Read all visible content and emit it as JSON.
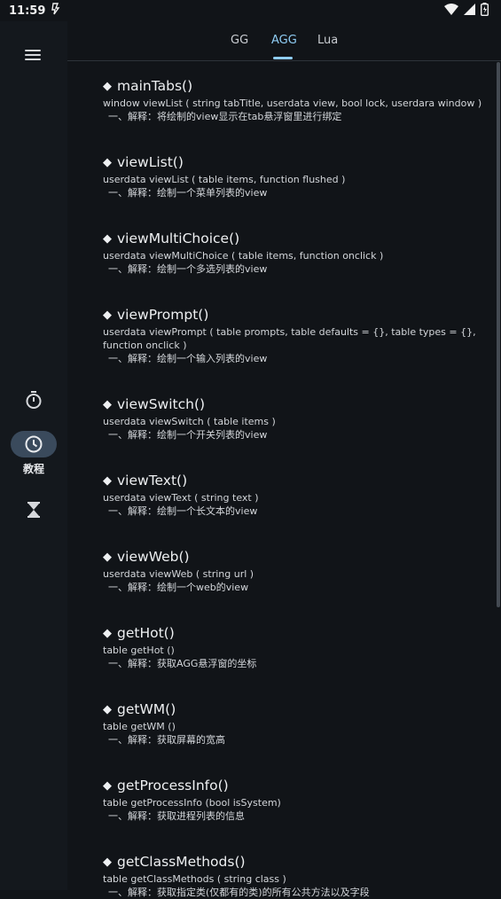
{
  "status_bar": {
    "time": "11:59"
  },
  "rail": {
    "nav_label": "教程"
  },
  "tabs": [
    {
      "label": "GG",
      "active": false
    },
    {
      "label": "AGG",
      "active": true
    },
    {
      "label": "Lua",
      "active": false
    }
  ],
  "entries": [
    {
      "title": "mainTabs()",
      "signature": "window viewList ( string tabTitle, userdata view, bool lock, userdara window )",
      "description": "一、解释：将绘制的view显示在tab悬浮窗里进行绑定"
    },
    {
      "title": "viewList()",
      "signature": "userdata viewList ( table items, function flushed )",
      "description": "一、解释：绘制一个菜单列表的view"
    },
    {
      "title": "viewMultiChoice()",
      "signature": "userdata viewMultiChoice ( table items, function onclick )",
      "description": "一、解释：绘制一个多选列表的view"
    },
    {
      "title": "viewPrompt()",
      "signature": "userdata viewPrompt ( table prompts, table defaults = {}, table types = {}, function onclick )",
      "description": "一、解释：绘制一个输入列表的view"
    },
    {
      "title": "viewSwitch()",
      "signature": "userdata viewSwitch ( table items )",
      "description": "一、解释：绘制一个开关列表的view"
    },
    {
      "title": "viewText()",
      "signature": "userdata viewText ( string text )",
      "description": "一、解释：绘制一个长文本的view"
    },
    {
      "title": "viewWeb()",
      "signature": "userdata viewWeb ( string url )",
      "description": "一、解释：绘制一个web的view"
    },
    {
      "title": "getHot()",
      "signature": "table getHot ()",
      "description": "一、解释：获取AGG悬浮窗的坐标"
    },
    {
      "title": "getWM()",
      "signature": "table getWM ()",
      "description": "一、解释：获取屏幕的宽高"
    },
    {
      "title": "getProcessInfo()",
      "signature": "table getProcessInfo (bool isSystem)",
      "description": "一、解释：获取进程列表的信息"
    },
    {
      "title": "getClassMethods()",
      "signature": "table getClassMethods ( string class )",
      "description": "一、解释：获取指定类(仅都有的类)的所有公共方法以及字段"
    }
  ]
}
